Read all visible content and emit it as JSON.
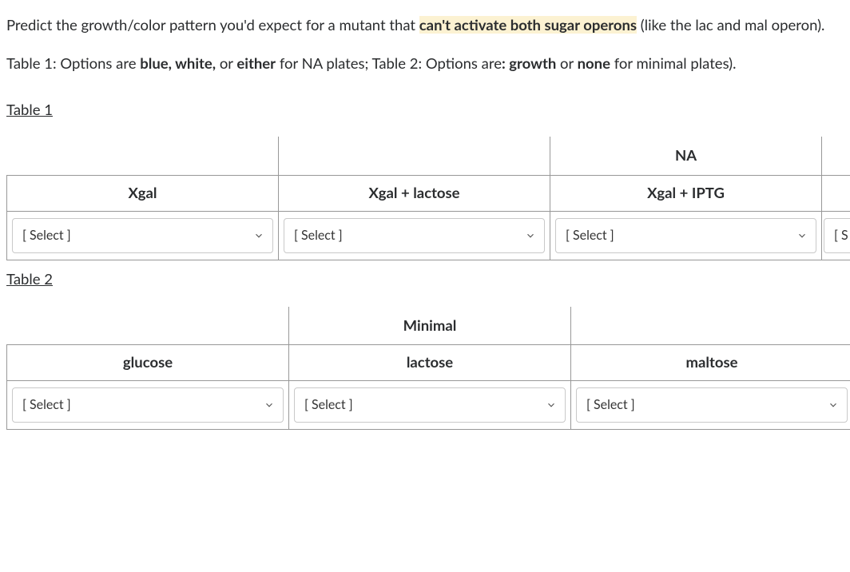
{
  "intro": {
    "line1a": "Predict the growth/color pattern you'd expect for a mutant that ",
    "line1_hl": "can't activate both sugar operons",
    "line1b": " (like the lac and mal operon).",
    "line2a": "Table 1: Options are ",
    "line2_b1": "blue, white,",
    "line2b": " or ",
    "line2_b2": "either",
    "line2c": " for NA plates; Table 2: Options are",
    "line2_b3": ": growth",
    "line2d": " or ",
    "line2_b4": "none",
    "line2e": " for minimal plates)."
  },
  "table1": {
    "label": "Table 1",
    "group_header": "NA",
    "cols": [
      "Xgal",
      "Xgal + lactose",
      "Xgal + IPTG"
    ],
    "selects": [
      "[ Select ]",
      "[ Select ]",
      "[ Select ]"
    ],
    "cutoff_select": "[ S"
  },
  "table2": {
    "label": "Table 2",
    "group_header": "Minimal",
    "cols": [
      "glucose",
      "lactose",
      "maltose"
    ],
    "selects": [
      "[ Select ]",
      "[ Select ]",
      "[ Select ]"
    ]
  },
  "options": {
    "table1": [
      "blue",
      "white",
      "either"
    ],
    "table2": [
      "growth",
      "none"
    ]
  }
}
